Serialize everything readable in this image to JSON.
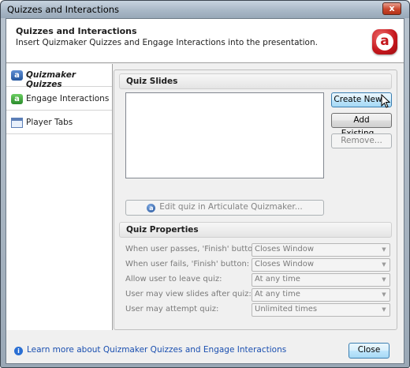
{
  "window": {
    "title": "Quizzes and Interactions",
    "close_glyph": "x"
  },
  "header": {
    "title": "Quizzes and Interactions",
    "subtitle": "Insert Quizmaker Quizzes and Engage Interactions into the presentation.",
    "logo_icon": "articulate-logo-icon",
    "logo_letter": "a"
  },
  "sidebar": {
    "items": [
      {
        "label": "Quizmaker Quizzes",
        "icon": "quizmaker-icon",
        "glyph": "a",
        "active": true
      },
      {
        "label": "Engage Interactions",
        "icon": "engage-icon",
        "glyph": "a",
        "active": false
      },
      {
        "label": "Player Tabs",
        "icon": "player-tabs-icon",
        "glyph": "",
        "active": false
      }
    ]
  },
  "quiz_slides": {
    "title": "Quiz Slides",
    "create_new": "Create New...",
    "add_existing": "Add Existing...",
    "remove": "Remove...",
    "edit": "Edit quiz in Articulate Quizmaker..."
  },
  "quiz_properties": {
    "title": "Quiz Properties",
    "rows": [
      {
        "label": "When user passes, 'Finish' button:",
        "value": "Closes Window"
      },
      {
        "label": "When user fails, 'Finish' button:",
        "value": "Closes Window"
      },
      {
        "label": "Allow user to leave quiz:",
        "value": "At any time"
      },
      {
        "label": "User may view slides after quiz:",
        "value": "At any time"
      },
      {
        "label": "User may attempt quiz:",
        "value": "Unlimited times"
      }
    ]
  },
  "footer": {
    "link": "Learn more about Quizmaker Quizzes and Engage Interactions",
    "close": "Close",
    "info_glyph": "i"
  },
  "colors": {
    "logo": "#c4161c",
    "link": "#1a4fb0"
  }
}
